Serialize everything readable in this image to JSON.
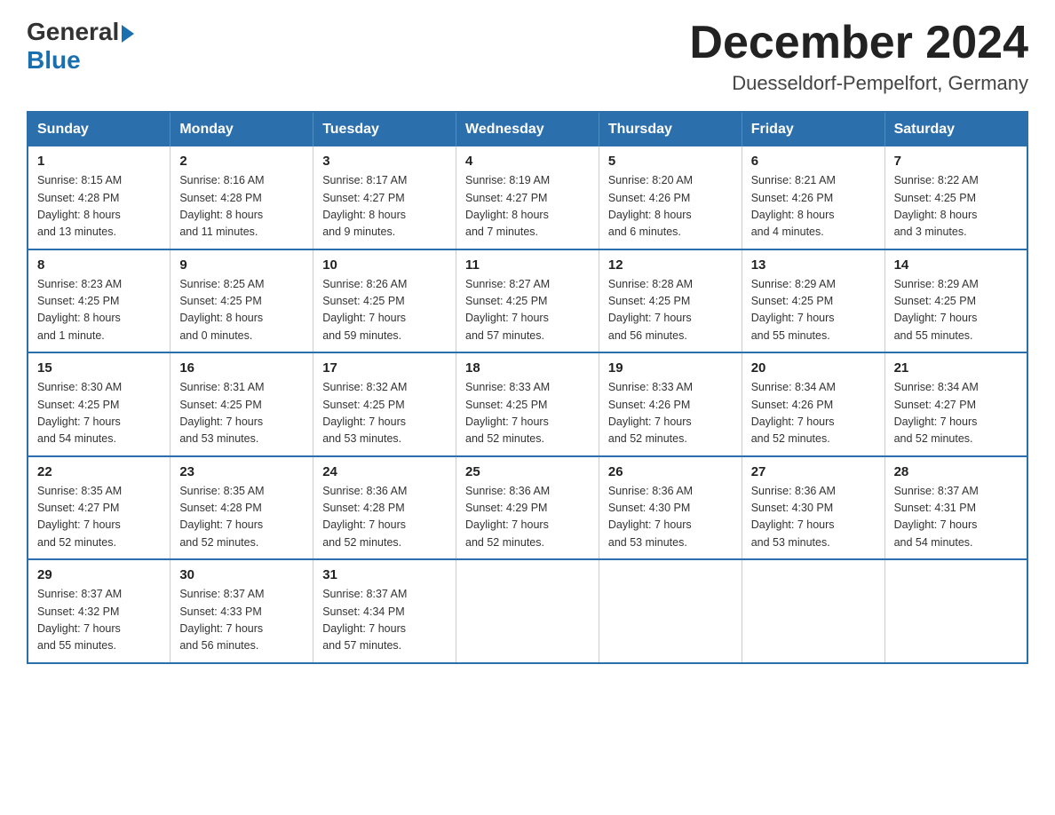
{
  "header": {
    "logo_general": "General",
    "logo_blue": "Blue",
    "title": "December 2024",
    "subtitle": "Duesseldorf-Pempelfort, Germany"
  },
  "weekdays": [
    "Sunday",
    "Monday",
    "Tuesday",
    "Wednesday",
    "Thursday",
    "Friday",
    "Saturday"
  ],
  "weeks": [
    [
      {
        "day": "1",
        "info": "Sunrise: 8:15 AM\nSunset: 4:28 PM\nDaylight: 8 hours\nand 13 minutes."
      },
      {
        "day": "2",
        "info": "Sunrise: 8:16 AM\nSunset: 4:28 PM\nDaylight: 8 hours\nand 11 minutes."
      },
      {
        "day": "3",
        "info": "Sunrise: 8:17 AM\nSunset: 4:27 PM\nDaylight: 8 hours\nand 9 minutes."
      },
      {
        "day": "4",
        "info": "Sunrise: 8:19 AM\nSunset: 4:27 PM\nDaylight: 8 hours\nand 7 minutes."
      },
      {
        "day": "5",
        "info": "Sunrise: 8:20 AM\nSunset: 4:26 PM\nDaylight: 8 hours\nand 6 minutes."
      },
      {
        "day": "6",
        "info": "Sunrise: 8:21 AM\nSunset: 4:26 PM\nDaylight: 8 hours\nand 4 minutes."
      },
      {
        "day": "7",
        "info": "Sunrise: 8:22 AM\nSunset: 4:25 PM\nDaylight: 8 hours\nand 3 minutes."
      }
    ],
    [
      {
        "day": "8",
        "info": "Sunrise: 8:23 AM\nSunset: 4:25 PM\nDaylight: 8 hours\nand 1 minute."
      },
      {
        "day": "9",
        "info": "Sunrise: 8:25 AM\nSunset: 4:25 PM\nDaylight: 8 hours\nand 0 minutes."
      },
      {
        "day": "10",
        "info": "Sunrise: 8:26 AM\nSunset: 4:25 PM\nDaylight: 7 hours\nand 59 minutes."
      },
      {
        "day": "11",
        "info": "Sunrise: 8:27 AM\nSunset: 4:25 PM\nDaylight: 7 hours\nand 57 minutes."
      },
      {
        "day": "12",
        "info": "Sunrise: 8:28 AM\nSunset: 4:25 PM\nDaylight: 7 hours\nand 56 minutes."
      },
      {
        "day": "13",
        "info": "Sunrise: 8:29 AM\nSunset: 4:25 PM\nDaylight: 7 hours\nand 55 minutes."
      },
      {
        "day": "14",
        "info": "Sunrise: 8:29 AM\nSunset: 4:25 PM\nDaylight: 7 hours\nand 55 minutes."
      }
    ],
    [
      {
        "day": "15",
        "info": "Sunrise: 8:30 AM\nSunset: 4:25 PM\nDaylight: 7 hours\nand 54 minutes."
      },
      {
        "day": "16",
        "info": "Sunrise: 8:31 AM\nSunset: 4:25 PM\nDaylight: 7 hours\nand 53 minutes."
      },
      {
        "day": "17",
        "info": "Sunrise: 8:32 AM\nSunset: 4:25 PM\nDaylight: 7 hours\nand 53 minutes."
      },
      {
        "day": "18",
        "info": "Sunrise: 8:33 AM\nSunset: 4:25 PM\nDaylight: 7 hours\nand 52 minutes."
      },
      {
        "day": "19",
        "info": "Sunrise: 8:33 AM\nSunset: 4:26 PM\nDaylight: 7 hours\nand 52 minutes."
      },
      {
        "day": "20",
        "info": "Sunrise: 8:34 AM\nSunset: 4:26 PM\nDaylight: 7 hours\nand 52 minutes."
      },
      {
        "day": "21",
        "info": "Sunrise: 8:34 AM\nSunset: 4:27 PM\nDaylight: 7 hours\nand 52 minutes."
      }
    ],
    [
      {
        "day": "22",
        "info": "Sunrise: 8:35 AM\nSunset: 4:27 PM\nDaylight: 7 hours\nand 52 minutes."
      },
      {
        "day": "23",
        "info": "Sunrise: 8:35 AM\nSunset: 4:28 PM\nDaylight: 7 hours\nand 52 minutes."
      },
      {
        "day": "24",
        "info": "Sunrise: 8:36 AM\nSunset: 4:28 PM\nDaylight: 7 hours\nand 52 minutes."
      },
      {
        "day": "25",
        "info": "Sunrise: 8:36 AM\nSunset: 4:29 PM\nDaylight: 7 hours\nand 52 minutes."
      },
      {
        "day": "26",
        "info": "Sunrise: 8:36 AM\nSunset: 4:30 PM\nDaylight: 7 hours\nand 53 minutes."
      },
      {
        "day": "27",
        "info": "Sunrise: 8:36 AM\nSunset: 4:30 PM\nDaylight: 7 hours\nand 53 minutes."
      },
      {
        "day": "28",
        "info": "Sunrise: 8:37 AM\nSunset: 4:31 PM\nDaylight: 7 hours\nand 54 minutes."
      }
    ],
    [
      {
        "day": "29",
        "info": "Sunrise: 8:37 AM\nSunset: 4:32 PM\nDaylight: 7 hours\nand 55 minutes."
      },
      {
        "day": "30",
        "info": "Sunrise: 8:37 AM\nSunset: 4:33 PM\nDaylight: 7 hours\nand 56 minutes."
      },
      {
        "day": "31",
        "info": "Sunrise: 8:37 AM\nSunset: 4:34 PM\nDaylight: 7 hours\nand 57 minutes."
      },
      {
        "day": "",
        "info": ""
      },
      {
        "day": "",
        "info": ""
      },
      {
        "day": "",
        "info": ""
      },
      {
        "day": "",
        "info": ""
      }
    ]
  ]
}
